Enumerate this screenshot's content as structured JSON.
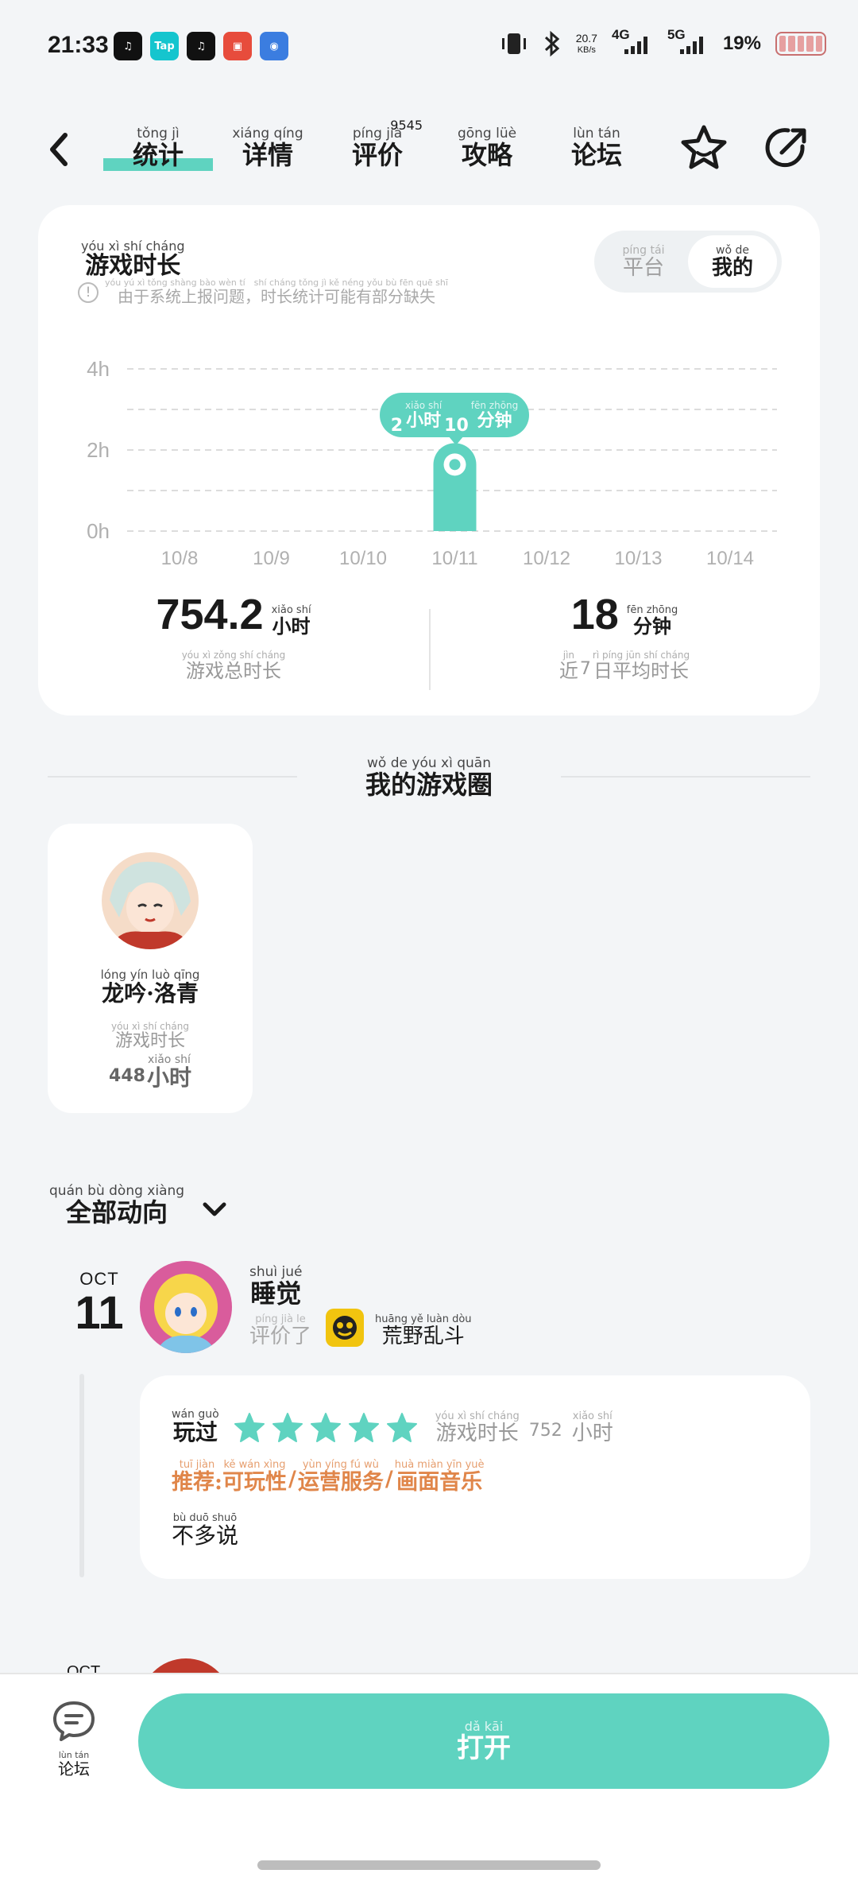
{
  "status_bar": {
    "time": "21:33",
    "net_speed": "20.7",
    "net_unit": "KB/s",
    "signal1": "4G",
    "signal2": "5G",
    "battery": "19%",
    "app_icons": [
      "music-icon",
      "taptap-icon",
      "music-icon",
      "game-app-icon",
      "browser-icon"
    ],
    "tap_label": "Tap"
  },
  "nav": {
    "tabs": [
      {
        "han": "统计",
        "pin": "tǒng jì"
      },
      {
        "han": "详情",
        "pin": "xiáng qíng"
      },
      {
        "han": "评价",
        "pin": "píng jià"
      },
      {
        "han": "攻略",
        "pin": "gōng lüè"
      },
      {
        "han": "论坛",
        "pin": "lùn tán"
      }
    ],
    "review_count": "9545"
  },
  "stats": {
    "title": {
      "han": "游戏时长",
      "pin": "yóu xì shí cháng"
    },
    "notice": {
      "han": "由于系统上报问题，时长统计可能有部分缺失",
      "pin": "yóu yú xì tǒng shàng bào wèn tí　shí cháng tǒng jì kě néng yǒu bù fēn quē shī"
    },
    "segment": [
      {
        "han": "平台",
        "pin": "píng tái"
      },
      {
        "han": "我的",
        "pin": "wǒ de"
      }
    ],
    "tooltip": {
      "num": "2",
      "unit1": {
        "han": "小时",
        "pin": "xiǎo shí"
      },
      "num2": "10",
      "unit2": {
        "han": "分钟",
        "pin": "fēn zhōng"
      }
    },
    "total": {
      "value": "754.2",
      "unit": {
        "han": "小时",
        "pin": "xiǎo shí"
      },
      "label": {
        "han": "游戏总时长",
        "pin": "yóu xì zǒng shí cháng"
      }
    },
    "recent": {
      "value": "18",
      "unit": {
        "han": "分钟",
        "pin": "fēn zhōng"
      },
      "label_pre": {
        "han": "近",
        "pin": "jìn"
      },
      "label_num": "7",
      "label": {
        "han": "日平均时长",
        "pin": "rì píng jūn shí cháng"
      }
    }
  },
  "chart_data": {
    "type": "bar",
    "categories": [
      "10/8",
      "10/9",
      "10/10",
      "10/11",
      "10/12",
      "10/13",
      "10/14"
    ],
    "values": [
      0,
      0,
      0,
      2.17,
      0,
      0,
      0
    ],
    "y_ticks": [
      "0h",
      "2h",
      "4h"
    ],
    "ylim": [
      0,
      4
    ],
    "grid": true,
    "bar_color": "#5fd3c0"
  },
  "circle_section": {
    "title": {
      "han": "我的游戏圈",
      "pin": "wǒ de yóu xì quān"
    },
    "card": {
      "name": {
        "han": "龙吟·洛青",
        "pin": "lóng yín luò qīng"
      },
      "sub": {
        "han": "游戏时长",
        "pin": "yóu xì shí cháng"
      },
      "hours": "448",
      "unit": {
        "han": "小时",
        "pin": "xiǎo shí"
      }
    }
  },
  "feed": {
    "filter": {
      "han": "全部动向",
      "pin": "quán bù dòng xiàng"
    },
    "entry": {
      "month": "OCT",
      "day": "11",
      "user": {
        "han": "睡觉",
        "pin": "shuì jué"
      },
      "action": {
        "han": "评价了",
        "pin": "píng jià le"
      },
      "game": {
        "han": "荒野乱斗",
        "pin": "huāng yě luàn dòu"
      },
      "played": {
        "han": "玩过",
        "pin": "wán guò"
      },
      "rating": 5,
      "playtime_label": {
        "han": "游戏时长",
        "pin": "yóu xì shí cháng"
      },
      "playtime_value": "752",
      "playtime_unit": {
        "han": "小时",
        "pin": "xiǎo shí"
      },
      "recommend": [
        {
          "han": "推荐:",
          "pin": "tuī jiàn"
        },
        {
          "han": "可玩性",
          "pin": "kě wán xìng"
        },
        {
          "han": "运营服务",
          "pin": "yùn yíng fú wù"
        },
        {
          "han": "画面音乐",
          "pin": "huà miàn yīn yuè"
        }
      ],
      "text": {
        "han": "不多说",
        "pin": "bù duō shuō"
      }
    }
  },
  "bottom": {
    "forum": {
      "han": "论坛",
      "pin": "lùn tán"
    },
    "open": {
      "han": "打开",
      "pin": "dǎ kāi"
    }
  },
  "colors": {
    "accent": "#5fd3c0",
    "recommend": "#e0864a",
    "background": "#f3f5f7"
  }
}
